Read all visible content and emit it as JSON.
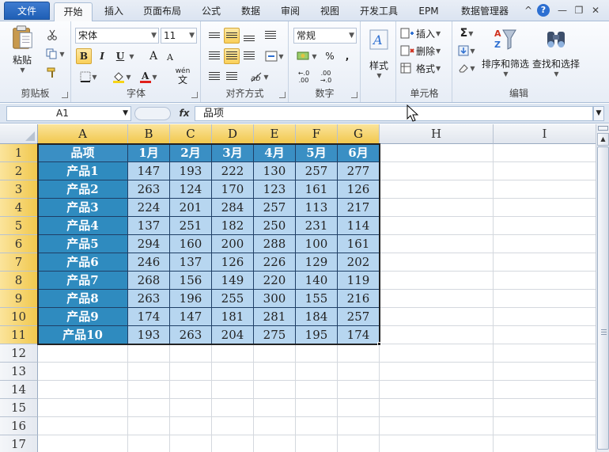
{
  "tabs": {
    "file": "文件",
    "items": [
      "开始",
      "插入",
      "页面布局",
      "公式",
      "数据",
      "审阅",
      "视图",
      "开发工具",
      "EPM",
      "数据管理器"
    ],
    "active_index": 0
  },
  "window_controls": {
    "help": "?",
    "minimize": "—",
    "restore": "❐",
    "close": "✕",
    "collapse": "^"
  },
  "ribbon": {
    "clipboard": {
      "label": "剪贴板",
      "paste": "粘贴",
      "paste_arrow": "▼"
    },
    "font": {
      "label": "字体",
      "font_name": "宋体",
      "font_size": "11",
      "bold": "B",
      "italic": "I",
      "underline": "U",
      "grow": "A",
      "shrink": "A",
      "pinyin": "wén"
    },
    "alignment": {
      "label": "对齐方式"
    },
    "number": {
      "label": "数字",
      "format": "常规",
      "percent": "%",
      "comma": ",",
      "inc_decimal": "←.0 .00",
      "dec_decimal": ".00 →.0"
    },
    "styles": {
      "label": "样式",
      "button": "样式"
    },
    "cells": {
      "label": "单元格",
      "insert": "插入",
      "delete": "删除",
      "format": "格式"
    },
    "editing": {
      "label": "编辑",
      "sum": "Σ",
      "sort_filter": "排序和筛选",
      "find_select": "查找和选择"
    }
  },
  "formula_bar": {
    "name_box": "A1",
    "fx": "fx",
    "content": "品项"
  },
  "sheet": {
    "columns": [
      "A",
      "B",
      "C",
      "D",
      "E",
      "F",
      "G",
      "H",
      "I"
    ],
    "highlighted_columns": 7,
    "highlighted_rows": 11,
    "rows": [
      "1",
      "2",
      "3",
      "4",
      "5",
      "6",
      "7",
      "8",
      "9",
      "10",
      "11",
      "12",
      "13",
      "14",
      "15",
      "16",
      "17"
    ],
    "table": {
      "header": [
        "品项",
        "1月",
        "2月",
        "3月",
        "4月",
        "5月",
        "6月"
      ],
      "body": [
        [
          "产品1",
          "147",
          "193",
          "222",
          "130",
          "257",
          "277"
        ],
        [
          "产品2",
          "263",
          "124",
          "170",
          "123",
          "161",
          "126"
        ],
        [
          "产品3",
          "224",
          "201",
          "284",
          "257",
          "113",
          "217"
        ],
        [
          "产品4",
          "137",
          "251",
          "182",
          "250",
          "231",
          "114"
        ],
        [
          "产品5",
          "294",
          "160",
          "200",
          "288",
          "100",
          "161"
        ],
        [
          "产品6",
          "246",
          "137",
          "126",
          "226",
          "129",
          "202"
        ],
        [
          "产品7",
          "268",
          "156",
          "149",
          "220",
          "140",
          "119"
        ],
        [
          "产品8",
          "263",
          "196",
          "255",
          "300",
          "155",
          "216"
        ],
        [
          "产品9",
          "174",
          "147",
          "181",
          "281",
          "184",
          "257"
        ],
        [
          "产品10",
          "193",
          "263",
          "204",
          "275",
          "195",
          "174"
        ]
      ]
    },
    "colors": {
      "header_fill": "#3a8fc4",
      "label_fill": "#2f8bbf",
      "value_fill": "#b7d6f0",
      "header_highlight": "#f1c84e"
    }
  }
}
